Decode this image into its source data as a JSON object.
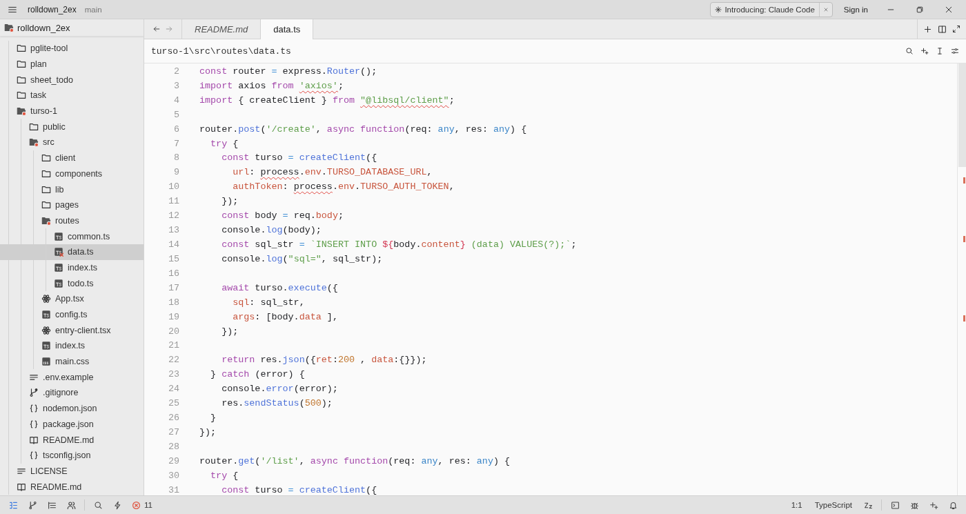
{
  "title_bar": {
    "project": "rolldown_2ex",
    "branch": "main",
    "banner": "Introducing: Claude Code",
    "sign_in": "Sign in"
  },
  "sidebar": {
    "root": {
      "label": "rolldown_2ex",
      "expanded": true,
      "error": true
    },
    "items": [
      {
        "label": "pglite-tool",
        "kind": "folder",
        "expanded": false,
        "error": false,
        "selected": false
      },
      {
        "label": "plan",
        "kind": "folder",
        "expanded": false,
        "error": false,
        "selected": false
      },
      {
        "label": "sheet_todo",
        "kind": "folder",
        "expanded": false,
        "error": false,
        "selected": false
      },
      {
        "label": "task",
        "kind": "folder",
        "expanded": false,
        "error": false,
        "selected": false
      },
      {
        "label": "turso-1",
        "kind": "folder",
        "expanded": true,
        "error": true,
        "selected": false,
        "children": [
          {
            "label": "public",
            "kind": "folder",
            "expanded": false,
            "error": false,
            "selected": false
          },
          {
            "label": "src",
            "kind": "folder",
            "expanded": true,
            "error": true,
            "selected": false,
            "children": [
              {
                "label": "client",
                "kind": "folder",
                "expanded": false,
                "error": false,
                "selected": false
              },
              {
                "label": "components",
                "kind": "folder",
                "expanded": false,
                "error": false,
                "selected": false
              },
              {
                "label": "lib",
                "kind": "folder",
                "expanded": false,
                "error": false,
                "selected": false
              },
              {
                "label": "pages",
                "kind": "folder",
                "expanded": false,
                "error": false,
                "selected": false
              },
              {
                "label": "routes",
                "kind": "folder",
                "expanded": true,
                "error": true,
                "selected": false,
                "children": [
                  {
                    "label": "common.ts",
                    "kind": "typescript",
                    "error": false,
                    "selected": false
                  },
                  {
                    "label": "data.ts",
                    "kind": "typescript",
                    "error": true,
                    "selected": true
                  },
                  {
                    "label": "index.ts",
                    "kind": "typescript",
                    "error": false,
                    "selected": false
                  },
                  {
                    "label": "todo.ts",
                    "kind": "typescript",
                    "error": false,
                    "selected": false
                  }
                ]
              },
              {
                "label": "App.tsx",
                "kind": "react",
                "error": false,
                "selected": false
              },
              {
                "label": "config.ts",
                "kind": "typescript",
                "error": false,
                "selected": false
              },
              {
                "label": "entry-client.tsx",
                "kind": "react",
                "error": false,
                "selected": false
              },
              {
                "label": "index.ts",
                "kind": "typescript",
                "error": false,
                "selected": false
              },
              {
                "label": "main.css",
                "kind": "css",
                "error": false,
                "selected": false
              }
            ]
          },
          {
            "label": ".env.example",
            "kind": "text",
            "error": false,
            "selected": false
          },
          {
            "label": ".gitignore",
            "kind": "git",
            "error": false,
            "selected": false
          },
          {
            "label": "nodemon.json",
            "kind": "json",
            "error": false,
            "selected": false
          },
          {
            "label": "package.json",
            "kind": "json",
            "error": false,
            "selected": false
          },
          {
            "label": "README.md",
            "kind": "book",
            "error": false,
            "selected": false
          },
          {
            "label": "tsconfig.json",
            "kind": "json",
            "error": false,
            "selected": false
          }
        ]
      },
      {
        "label": "LICENSE",
        "kind": "text",
        "error": false,
        "selected": false
      },
      {
        "label": "README.md",
        "kind": "book",
        "error": false,
        "selected": false
      }
    ]
  },
  "tabs": [
    {
      "label": "README.md",
      "selected": false,
      "preview": true
    },
    {
      "label": "data.ts",
      "selected": true,
      "preview": false
    }
  ],
  "breadcrumb": "turso-1\\src\\routes\\data.ts",
  "code_lines": [
    {
      "number": "2",
      "tokens": [
        {
          "kind": "keyword",
          "text": "const"
        },
        {
          "kind": "plain",
          "text": " router "
        },
        {
          "kind": "operator",
          "text": "="
        },
        {
          "kind": "plain",
          "text": " express."
        },
        {
          "kind": "function",
          "text": "Router"
        },
        {
          "kind": "plain",
          "text": "();"
        }
      ]
    },
    {
      "number": "3",
      "tokens": [
        {
          "kind": "keyword",
          "text": "import"
        },
        {
          "kind": "plain",
          "text": " axios "
        },
        {
          "kind": "keyword",
          "text": "from "
        },
        {
          "kind": "string-error",
          "text": "'axios'"
        },
        {
          "kind": "plain",
          "text": ";"
        }
      ]
    },
    {
      "number": "4",
      "tokens": [
        {
          "kind": "keyword",
          "text": "import"
        },
        {
          "kind": "plain",
          "text": " { createClient } "
        },
        {
          "kind": "keyword",
          "text": "from "
        },
        {
          "kind": "string-error",
          "text": "\"@libsql/client\""
        },
        {
          "kind": "plain",
          "text": ";"
        }
      ]
    },
    {
      "number": "5"
    },
    {
      "number": "6",
      "tokens": [
        {
          "kind": "plain",
          "text": "router."
        },
        {
          "kind": "function",
          "text": "post"
        },
        {
          "kind": "plain",
          "text": "("
        },
        {
          "kind": "string",
          "text": "'/create'"
        },
        {
          "kind": "plain",
          "text": ", "
        },
        {
          "kind": "keyword",
          "text": "async "
        },
        {
          "kind": "keyword",
          "text": "function"
        },
        {
          "kind": "plain",
          "text": "(req: "
        },
        {
          "kind": "type",
          "text": "any"
        },
        {
          "kind": "plain",
          "text": ", res: "
        },
        {
          "kind": "type",
          "text": "any"
        },
        {
          "kind": "plain",
          "text": ") {"
        }
      ]
    },
    {
      "number": "7",
      "tokens": [
        {
          "kind": "keyword",
          "text": "  try"
        },
        {
          "kind": "plain",
          "text": " {"
        }
      ]
    },
    {
      "number": "8",
      "tokens": [
        {
          "kind": "keyword",
          "text": "    const"
        },
        {
          "kind": "plain",
          "text": " turso "
        },
        {
          "kind": "operator",
          "text": "= "
        },
        {
          "kind": "function",
          "text": "createClient"
        },
        {
          "kind": "plain",
          "text": "({"
        }
      ]
    },
    {
      "number": "9",
      "tokens": [
        {
          "kind": "property",
          "text": "      url"
        },
        {
          "kind": "plain",
          "text": ": "
        },
        {
          "kind": "plain-error",
          "text": "process"
        },
        {
          "kind": "plain",
          "text": "."
        },
        {
          "kind": "property",
          "text": "env"
        },
        {
          "kind": "plain",
          "text": "."
        },
        {
          "kind": "property",
          "text": "TURSO_DATABASE_URL"
        },
        {
          "kind": "plain",
          "text": ","
        }
      ]
    },
    {
      "number": "10",
      "tokens": [
        {
          "kind": "property",
          "text": "      authToken"
        },
        {
          "kind": "plain",
          "text": ": "
        },
        {
          "kind": "plain-error",
          "text": "process"
        },
        {
          "kind": "plain",
          "text": "."
        },
        {
          "kind": "property",
          "text": "env"
        },
        {
          "kind": "plain",
          "text": "."
        },
        {
          "kind": "property",
          "text": "TURSO_AUTH_TOKEN"
        },
        {
          "kind": "plain",
          "text": ","
        }
      ]
    },
    {
      "number": "11",
      "tokens": [
        {
          "kind": "plain",
          "text": "    });"
        }
      ]
    },
    {
      "number": "12",
      "tokens": [
        {
          "kind": "keyword",
          "text": "    const"
        },
        {
          "kind": "plain",
          "text": " body "
        },
        {
          "kind": "operator",
          "text": "="
        },
        {
          "kind": "plain",
          "text": " req."
        },
        {
          "kind": "property",
          "text": "body"
        },
        {
          "kind": "plain",
          "text": ";"
        }
      ]
    },
    {
      "number": "13",
      "tokens": [
        {
          "kind": "plain",
          "text": "    console."
        },
        {
          "kind": "function",
          "text": "log"
        },
        {
          "kind": "plain",
          "text": "(body);"
        }
      ]
    },
    {
      "number": "14",
      "tokens": [
        {
          "kind": "keyword",
          "text": "    const"
        },
        {
          "kind": "plain",
          "text": " sql_str "
        },
        {
          "kind": "operator",
          "text": "= "
        },
        {
          "kind": "string",
          "text": "`INSERT INTO "
        },
        {
          "kind": "interpolation",
          "text": "${"
        },
        {
          "kind": "plain",
          "text": "body."
        },
        {
          "kind": "property",
          "text": "content"
        },
        {
          "kind": "interpolation",
          "text": "}"
        },
        {
          "kind": "string",
          "text": " (data) VALUES(?);`"
        },
        {
          "kind": "plain",
          "text": ";"
        }
      ]
    },
    {
      "number": "15",
      "tokens": [
        {
          "kind": "plain",
          "text": "    console."
        },
        {
          "kind": "function",
          "text": "log"
        },
        {
          "kind": "plain",
          "text": "("
        },
        {
          "kind": "string",
          "text": "\"sql=\""
        },
        {
          "kind": "plain",
          "text": ", sql_str);"
        }
      ]
    },
    {
      "number": "16"
    },
    {
      "number": "17",
      "tokens": [
        {
          "kind": "keyword",
          "text": "    await"
        },
        {
          "kind": "plain",
          "text": " turso."
        },
        {
          "kind": "function",
          "text": "execute"
        },
        {
          "kind": "plain",
          "text": "({"
        }
      ]
    },
    {
      "number": "18",
      "tokens": [
        {
          "kind": "property",
          "text": "      sql"
        },
        {
          "kind": "plain",
          "text": ": sql_str,"
        }
      ]
    },
    {
      "number": "19",
      "tokens": [
        {
          "kind": "property",
          "text": "      args"
        },
        {
          "kind": "plain",
          "text": ": [body."
        },
        {
          "kind": "property",
          "text": "data"
        },
        {
          "kind": "plain",
          "text": " ],"
        }
      ]
    },
    {
      "number": "20",
      "tokens": [
        {
          "kind": "plain",
          "text": "    });"
        }
      ]
    },
    {
      "number": "21"
    },
    {
      "number": "22",
      "tokens": [
        {
          "kind": "keyword",
          "text": "    return"
        },
        {
          "kind": "plain",
          "text": " res."
        },
        {
          "kind": "function",
          "text": "json"
        },
        {
          "kind": "plain",
          "text": "({"
        },
        {
          "kind": "property",
          "text": "ret"
        },
        {
          "kind": "plain",
          "text": ":"
        },
        {
          "kind": "number",
          "text": "200"
        },
        {
          "kind": "plain",
          "text": " , "
        },
        {
          "kind": "property",
          "text": "data"
        },
        {
          "kind": "plain",
          "text": ":{}});"
        }
      ]
    },
    {
      "number": "23",
      "tokens": [
        {
          "kind": "plain",
          "text": "  } "
        },
        {
          "kind": "keyword",
          "text": "catch"
        },
        {
          "kind": "plain",
          "text": " (error) {"
        }
      ]
    },
    {
      "number": "24",
      "tokens": [
        {
          "kind": "plain",
          "text": "    console."
        },
        {
          "kind": "function",
          "text": "error"
        },
        {
          "kind": "plain",
          "text": "(error);"
        }
      ]
    },
    {
      "number": "25",
      "tokens": [
        {
          "kind": "plain",
          "text": "    res."
        },
        {
          "kind": "function",
          "text": "sendStatus"
        },
        {
          "kind": "plain",
          "text": "("
        },
        {
          "kind": "number",
          "text": "500"
        },
        {
          "kind": "plain",
          "text": ");"
        }
      ]
    },
    {
      "number": "26",
      "tokens": [
        {
          "kind": "plain",
          "text": "  }"
        }
      ]
    },
    {
      "number": "27",
      "tokens": [
        {
          "kind": "plain",
          "text": "});"
        }
      ]
    },
    {
      "number": "28"
    },
    {
      "number": "29",
      "tokens": [
        {
          "kind": "plain",
          "text": "router."
        },
        {
          "kind": "function",
          "text": "get"
        },
        {
          "kind": "plain",
          "text": "("
        },
        {
          "kind": "string",
          "text": "'/list'"
        },
        {
          "kind": "plain",
          "text": ", "
        },
        {
          "kind": "keyword",
          "text": "async "
        },
        {
          "kind": "keyword",
          "text": "function"
        },
        {
          "kind": "plain",
          "text": "(req: "
        },
        {
          "kind": "type",
          "text": "any"
        },
        {
          "kind": "plain",
          "text": ", res: "
        },
        {
          "kind": "type",
          "text": "any"
        },
        {
          "kind": "plain",
          "text": ") {"
        }
      ]
    },
    {
      "number": "30",
      "tokens": [
        {
          "kind": "keyword",
          "text": "  try"
        },
        {
          "kind": "plain",
          "text": " {"
        }
      ]
    },
    {
      "number": "31",
      "tokens": [
        {
          "kind": "keyword",
          "text": "    const"
        },
        {
          "kind": "plain",
          "text": " turso "
        },
        {
          "kind": "operator",
          "text": "= "
        },
        {
          "kind": "function",
          "text": "createClient"
        },
        {
          "kind": "plain",
          "text": "({"
        }
      ]
    }
  ],
  "status_bar": {
    "tools": [
      {
        "kind": "project",
        "selected": true
      },
      {
        "kind": "git",
        "selected": false
      },
      {
        "kind": "outline",
        "selected": false
      },
      {
        "kind": "collab",
        "selected": false
      }
    ],
    "error_count": "11",
    "position": "1:1",
    "language": "TypeScript"
  }
}
